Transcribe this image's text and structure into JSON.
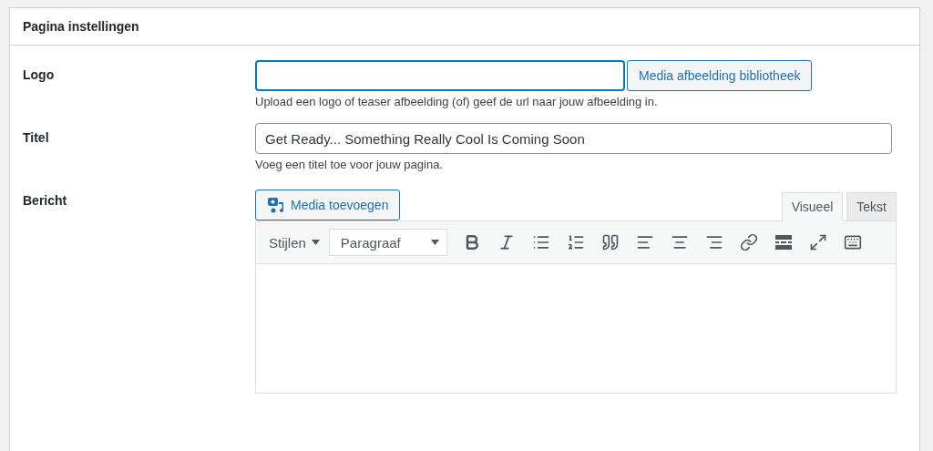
{
  "panel": {
    "title": "Pagina instellingen"
  },
  "fields": [
    {
      "kind": "upload",
      "label": "Logo",
      "focused": true,
      "button": "Media afbeelding bibliotheek",
      "hint": "Upload een logo of teaser afbeelding (of) geef de url naar jouw afbeelding in."
    },
    {
      "kind": "text",
      "label": "Titel",
      "value_text": "Get Ready... Something Really Cool Is Coming Soon",
      "focused": false,
      "hint": "Voeg een titel toe voor jouw pagina."
    },
    {
      "kind": "editor",
      "label": "Bericht",
      "media_button": "Media toevoegen",
      "tabs": [
        {
          "label": "Visueel",
          "selected": true
        },
        {
          "label": "Tekst",
          "selected": false
        }
      ],
      "styles": "Stijlen",
      "format": "Paragraaf",
      "tools": [
        {
          "kind": "bold"
        },
        {
          "kind": "italic"
        },
        {
          "kind": "bullets"
        },
        {
          "kind": "numbers"
        },
        {
          "kind": "quote"
        },
        {
          "kind": "left"
        },
        {
          "kind": "center"
        },
        {
          "kind": "right"
        },
        {
          "kind": "link"
        },
        {
          "kind": "more"
        },
        {
          "kind": "fullscreen"
        },
        {
          "kind": "toolbar"
        }
      ]
    }
  ]
}
